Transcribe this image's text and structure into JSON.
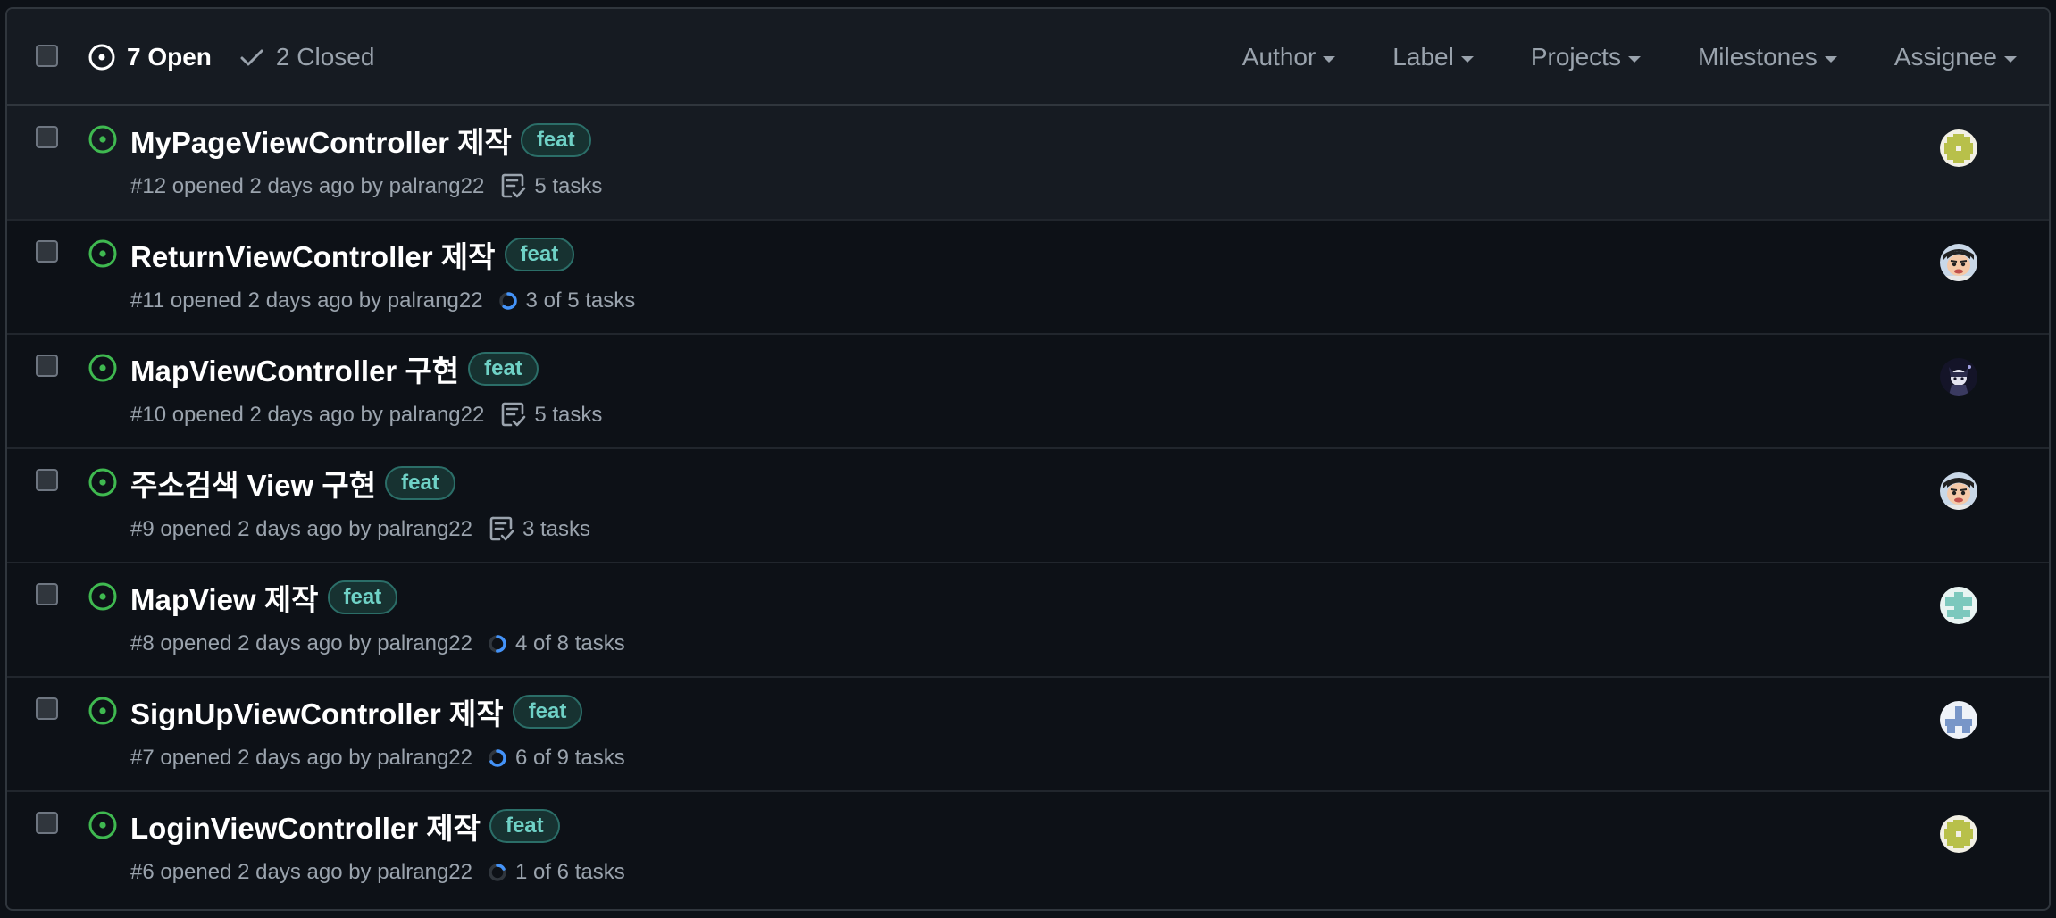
{
  "header": {
    "open_label": "7 Open",
    "closed_label": "2 Closed",
    "filters": [
      "Author",
      "Label",
      "Projects",
      "Milestones",
      "Assignee"
    ]
  },
  "colors": {
    "open_icon": "#3fb950",
    "label_text": "#6fd1c6",
    "progress": "#4493f8"
  },
  "issues": [
    {
      "title": "MyPageViewController 제작",
      "label": "feat",
      "meta": "#12 opened 2 days ago by palrang22",
      "tasks": "5 tasks",
      "task_type": "list",
      "progress": 0,
      "avatar": "identicon-olive"
    },
    {
      "title": "ReturnViewController 제작",
      "label": "feat",
      "meta": "#11 opened 2 days ago by palrang22",
      "tasks": "3 of 5 tasks",
      "task_type": "progress",
      "progress": 0.6,
      "avatar": "cartoon-face"
    },
    {
      "title": "MapViewController 구현",
      "label": "feat",
      "meta": "#10 opened 2 days ago by palrang22",
      "tasks": "5 tasks",
      "task_type": "list",
      "progress": 0,
      "avatar": "dark-character"
    },
    {
      "title": "주소검색 View 구현",
      "label": "feat",
      "meta": "#9 opened 2 days ago by palrang22",
      "tasks": "3 tasks",
      "task_type": "list",
      "progress": 0,
      "avatar": "cartoon-face"
    },
    {
      "title": "MapView 제작",
      "label": "feat",
      "meta": "#8 opened 2 days ago by palrang22",
      "tasks": "4 of 8 tasks",
      "task_type": "progress",
      "progress": 0.5,
      "avatar": "identicon-teal"
    },
    {
      "title": "SignUpViewController 제작",
      "label": "feat",
      "meta": "#7 opened 2 days ago by palrang22",
      "tasks": "6 of 9 tasks",
      "task_type": "progress",
      "progress": 0.6667,
      "avatar": "identicon-blue"
    },
    {
      "title": "LoginViewController 제작",
      "label": "feat",
      "meta": "#6 opened 2 days ago by palrang22",
      "tasks": "1 of 6 tasks",
      "task_type": "progress",
      "progress": 0.1667,
      "avatar": "identicon-olive"
    }
  ]
}
